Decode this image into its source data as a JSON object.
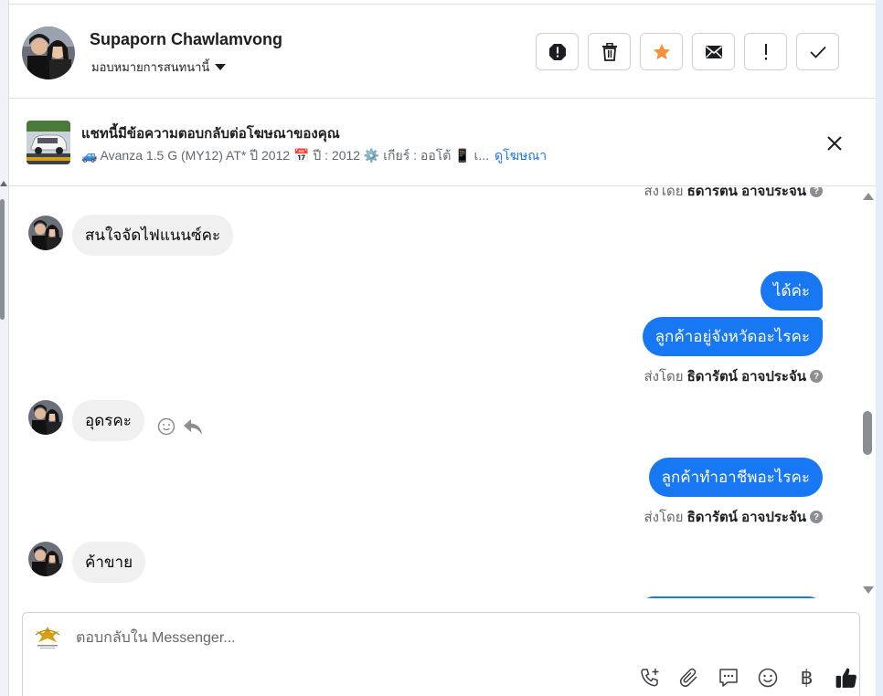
{
  "header": {
    "user_name": "Supaporn Chawlamvong",
    "assign_label": "มอบหมายการสนทนานี้",
    "actions": [
      {
        "icon": "alert-circle-icon"
      },
      {
        "icon": "trash-icon"
      },
      {
        "icon": "star-icon",
        "color": "#f7923b"
      },
      {
        "icon": "envelope-icon"
      },
      {
        "icon": "exclamation-icon"
      },
      {
        "icon": "check-icon"
      }
    ]
  },
  "ad": {
    "title": "แชทนี้มีข้อความตอบกลับต่อโฆษณาของคุณ",
    "subtitle": "🚙 Avanza 1.5 G (MY12) AT* ปี 2012 📅 ปี : 2012 ⚙️ เกียร์ : ออโต้ 📱 เ...",
    "link": "ดูโฆษณา"
  },
  "messages": {
    "top_sent_by_prefix": "ส่งโดย",
    "top_sent_by_name": "ธิดารัตน์ อาจประจัน",
    "m1": "สนใจจัดไฟแนนซ์คะ",
    "m2": "ได้ค่ะ",
    "m3": "ลูกค้าอยู่จังหวัดอะไรคะ",
    "sent_by_1_prefix": "ส่งโดย",
    "sent_by_1_name": "ธิดารัตน์ อาจประจัน",
    "m4": "อุดรคะ",
    "m5": "ลูกค้าทำอาชีพอะไรคะ",
    "sent_by_2_prefix": "ส่งโดย",
    "sent_by_2_name": "ธิดารัตน์ อาจประจัน",
    "m6": "ค้าขาย"
  },
  "composer": {
    "placeholder": "ตอบกลับใน Messenger...",
    "baht_symbol": "฿"
  },
  "colors": {
    "accent": "#1877f2",
    "incoming_bubble": "#f0f0f0",
    "star": "#f7923b"
  }
}
